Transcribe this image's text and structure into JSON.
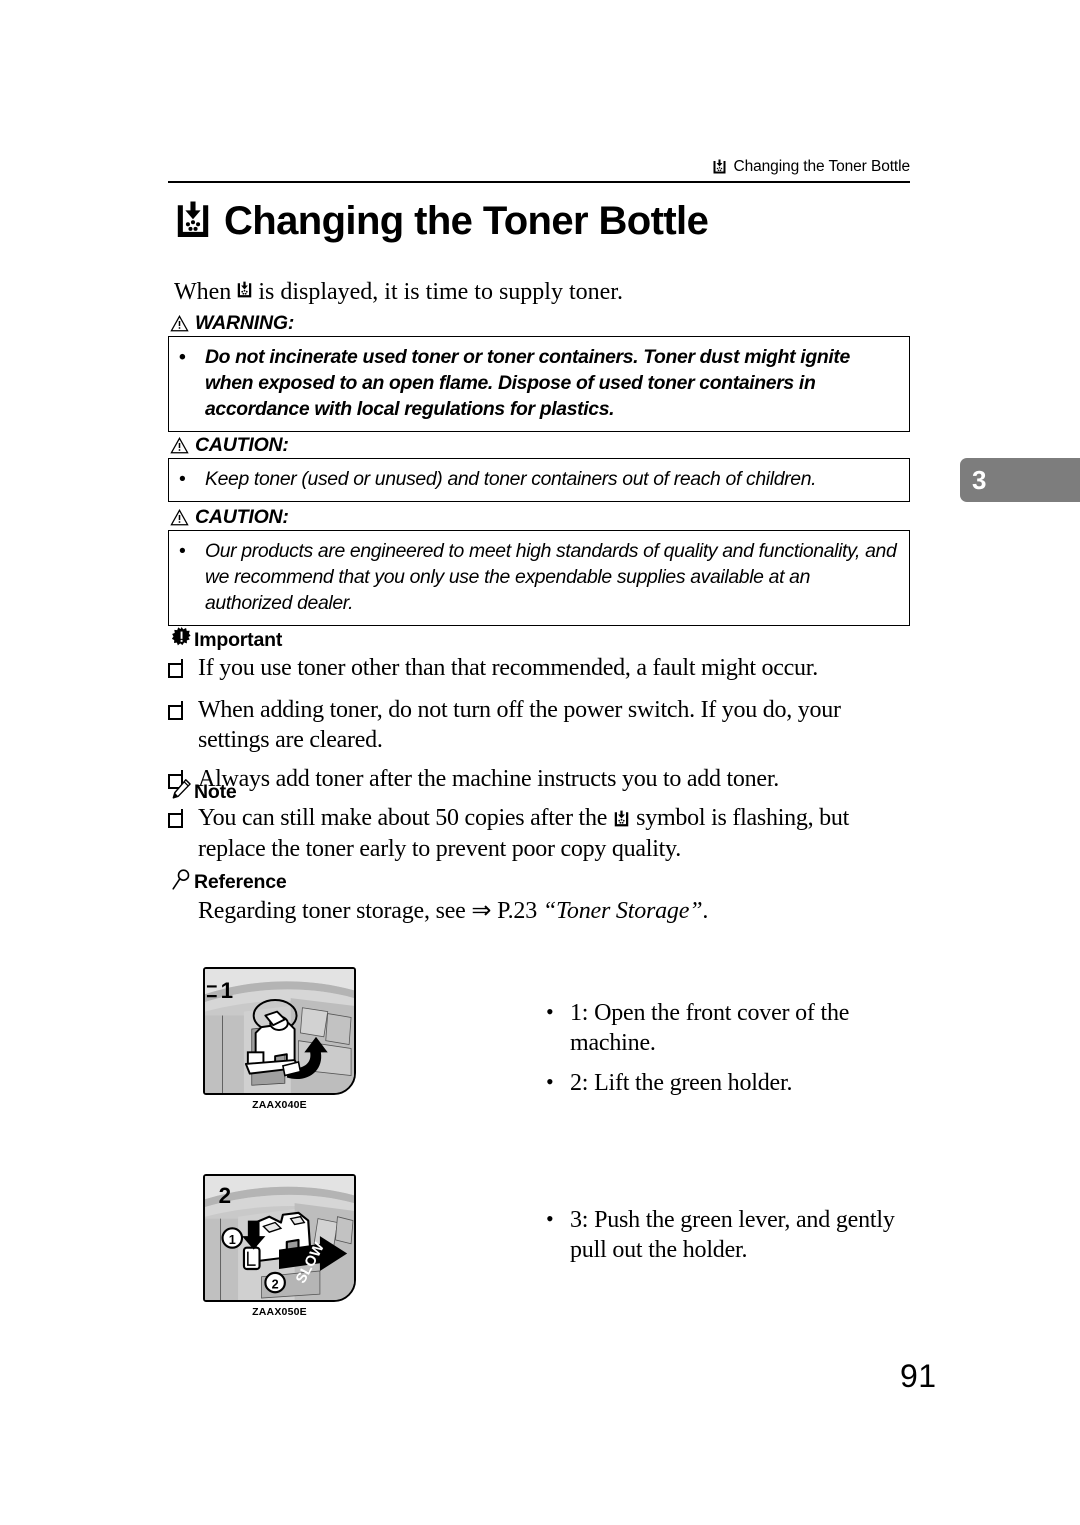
{
  "header": {
    "icon": "toner-bottle-icon",
    "text": "Changing the Toner Bottle"
  },
  "title": {
    "icon": "toner-bottle-icon",
    "text": "Changing the Toner Bottle"
  },
  "intro": {
    "before": "When",
    "icon": "toner-bottle-icon",
    "after": "is displayed, it is time to supply toner."
  },
  "warning": {
    "icon": "warning-triangle-icon",
    "label": "WARNING:",
    "bullet": "•",
    "text": "Do not incinerate used toner or toner containers. Toner dust might ignite when exposed to an open flame. Dispose of used toner containers in accordance with local regulations for plastics."
  },
  "caution1": {
    "icon": "warning-triangle-icon",
    "label": "CAUTION:",
    "bullet": "•",
    "text": "Keep toner (used or unused) and toner containers out of reach of children."
  },
  "caution2": {
    "icon": "warning-triangle-icon",
    "label": "CAUTION:",
    "bullet": "•",
    "text": "Our products are engineered to meet high standards of quality and functionality, and we recommend that you only use the expendable supplies available at an authorized dealer."
  },
  "important": {
    "icon": "important-burst-icon",
    "label": "Important",
    "items": [
      "If you use toner other than that recommended, a fault might occur.",
      "When adding toner, do not turn off the power switch. If you do, your settings are cleared.",
      "Always add toner after the machine instructs you to add toner."
    ]
  },
  "note": {
    "icon": "pencil-icon",
    "label": "Note",
    "item_before": "You can still make about 50 copies after the",
    "item_icon": "toner-bottle-icon",
    "item_after": "symbol is flashing, but replace the toner early to prevent poor copy quality."
  },
  "reference": {
    "icon": "magnifier-icon",
    "label": "Reference",
    "text_before": "Regarding toner storage, see ⇒ P.23 ",
    "text_italic": "“Toner Storage”",
    "text_after": "."
  },
  "figures": [
    {
      "name": "front-cover-green-holder",
      "step_number": "1",
      "caption": "ZAAX040E"
    },
    {
      "name": "green-lever-pull-holder",
      "step_number": "2",
      "callout_1": "1",
      "callout_2": "2",
      "arrow_label": "SLOW",
      "caption": "ZAAX050E"
    }
  ],
  "steps_group_1": {
    "bullet": "•",
    "items": [
      "1: Open the front cover of the machine.",
      "2: Lift the green holder."
    ]
  },
  "steps_group_2": {
    "bullet": "•",
    "items": [
      "3: Push the green lever, and gently pull out the holder."
    ]
  },
  "chapter_tab": {
    "number": "3",
    "color": "#7d7d7d"
  },
  "page_number": "91"
}
